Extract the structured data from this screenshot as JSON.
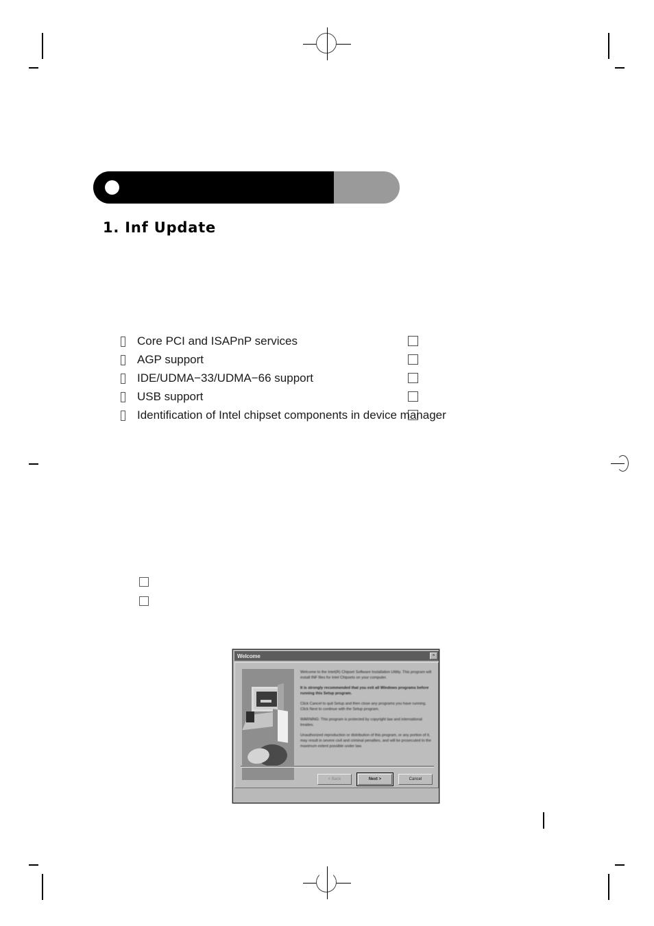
{
  "page": {
    "section_number_title": "1.  Inf Update"
  },
  "header": {
    "bar_black_color": "#000000",
    "bar_gray_color": "#9a9a9a",
    "dot_color": "#ffffff"
  },
  "features": {
    "bullet_glyph": "",
    "items": [
      {
        "text": "Core PCI and ISAPnP services",
        "trailing_square": true
      },
      {
        "text": "AGP support",
        "trailing_square": true
      },
      {
        "text": "IDE/UDMA−33/UDMA−66 support",
        "trailing_square": true
      },
      {
        "text": "USB support",
        "trailing_square": true
      },
      {
        "text": "Identification of Intel chipset components in device manager",
        "trailing_square": true
      }
    ]
  },
  "stray_squares": [
    {
      "label": "empty-square-1"
    },
    {
      "label": "empty-square-2"
    }
  ],
  "dialog": {
    "title": "Welcome",
    "close_glyph": "×",
    "paragraphs": [
      "Welcome to the Intel(R) Chipset Software Installation Utility. This program will install INF files for Intel Chipsets on your computer.",
      "It is strongly recommended that you exit all Windows programs before running this Setup program.",
      "Click Cancel to quit Setup and then close any programs you have running. Click Next to continue with the Setup program.",
      "WARNING: This program is protected by copyright law and international treaties.",
      "Unauthorized reproduction or distribution of this program, or any portion of it, may result in severe civil and criminal penalties, and will be prosecuted to the maximum extent possible under law."
    ],
    "paragraph_bold_flags": [
      false,
      true,
      false,
      false,
      false
    ],
    "buttons": [
      {
        "label": "< Back",
        "state": "disabled"
      },
      {
        "label": "Next >",
        "state": "default"
      },
      {
        "label": "Cancel",
        "state": "normal"
      }
    ]
  }
}
